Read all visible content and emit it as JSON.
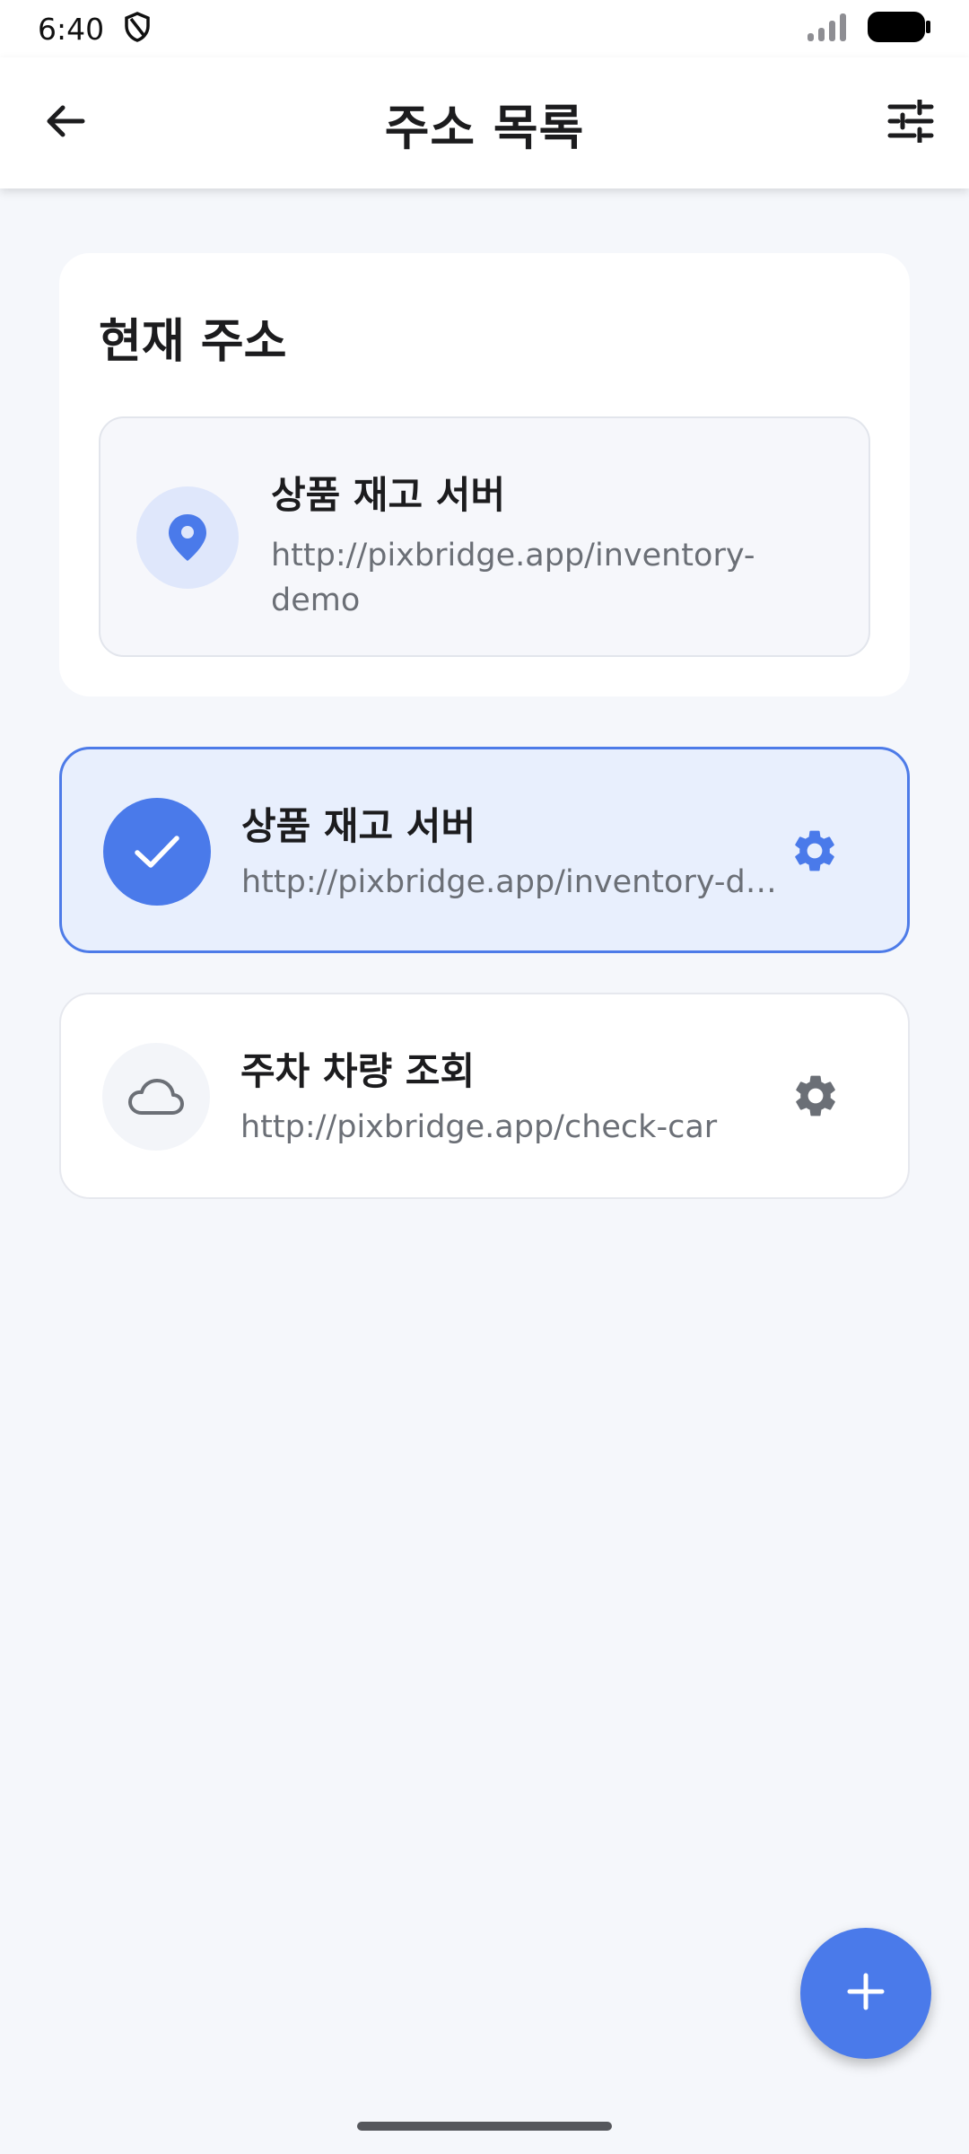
{
  "status_bar": {
    "time": "6:40",
    "icons": [
      "shield-icon",
      "signal-icon",
      "battery-icon"
    ]
  },
  "app_bar": {
    "title": "주소 목록",
    "left_icon": "back-arrow-icon",
    "right_icon": "tune-icon"
  },
  "current_address": {
    "heading": "현재 주소",
    "name": "상품 재고 서버",
    "url": "http://pixbridge.app/inventory-demo",
    "icon": "location-pin-icon"
  },
  "servers": [
    {
      "name": "상품 재고 서버",
      "url": "http://pixbridge.app/inventory-demo",
      "selected": true,
      "icon": "check-icon"
    },
    {
      "name": "주차 차량 조회",
      "url": "http://pixbridge.app/check-car",
      "selected": false,
      "icon": "cloud-icon"
    }
  ],
  "fab": {
    "icon": "plus-icon"
  },
  "colors": {
    "accent": "#4a7aea",
    "selected_bg": "#e8effd",
    "background": "#f5f7fb",
    "gear_selected": "#4a7aea",
    "gear_default": "#6b6f76"
  }
}
